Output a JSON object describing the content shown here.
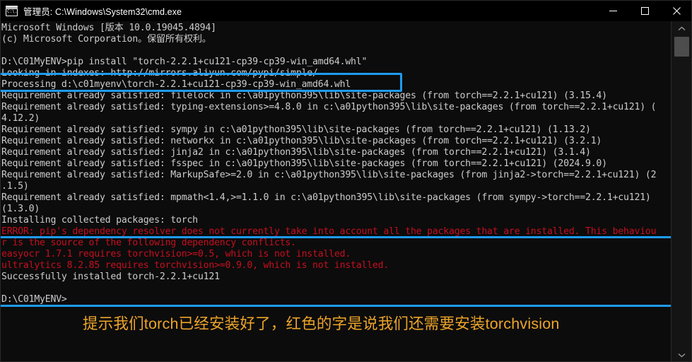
{
  "window": {
    "title": "管理员: C:\\Windows\\System32\\cmd.exe",
    "icon": "cmd-console-icon",
    "icon_glyph": "C:\\.",
    "minimize_label": "—",
    "maximize_label": "□",
    "close_label": "✕"
  },
  "colors": {
    "background": "#0c0c0c",
    "titlebar": "#000000",
    "text": "#cccccc",
    "error_text": "#c50f1f",
    "highlight_box": "#1e9bf0",
    "annotation_text": "#eda42a",
    "scrollbar_track": "#141414",
    "scrollbar_thumb": "#4d4d4d"
  },
  "console": {
    "lines": [
      {
        "text": "Microsoft Windows [版本 10.0.19045.4894]",
        "color": "white"
      },
      {
        "text": "(c) Microsoft Corporation。保留所有权利。",
        "color": "white"
      },
      {
        "text": "",
        "color": "white"
      },
      {
        "text": "D:\\C01MyENV>pip install \"torch-2.2.1+cu121-cp39-cp39-win_amd64.whl\"",
        "color": "white"
      },
      {
        "text": "Looking in indexes: http://mirrors.aliyun.com/pypi/simple/",
        "color": "white"
      },
      {
        "text": "Processing d:\\c01myenv\\torch-2.2.1+cu121-cp39-cp39-win_amd64.whl",
        "color": "white"
      },
      {
        "text": "Requirement already satisfied: filelock in c:\\a01python395\\lib\\site-packages (from torch==2.2.1+cu121) (3.15.4)",
        "color": "white"
      },
      {
        "text": "Requirement already satisfied: typing-extensions>=4.8.0 in c:\\a01python395\\lib\\site-packages (from torch==2.2.1+cu121) (",
        "color": "white"
      },
      {
        "text": "4.12.2)",
        "color": "white"
      },
      {
        "text": "Requirement already satisfied: sympy in c:\\a01python395\\lib\\site-packages (from torch==2.2.1+cu121) (1.13.2)",
        "color": "white"
      },
      {
        "text": "Requirement already satisfied: networkx in c:\\a01python395\\lib\\site-packages (from torch==2.2.1+cu121) (3.2.1)",
        "color": "white"
      },
      {
        "text": "Requirement already satisfied: jinja2 in c:\\a01python395\\lib\\site-packages (from torch==2.2.1+cu121) (3.1.4)",
        "color": "white"
      },
      {
        "text": "Requirement already satisfied: fsspec in c:\\a01python395\\lib\\site-packages (from torch==2.2.1+cu121) (2024.9.0)",
        "color": "white"
      },
      {
        "text": "Requirement already satisfied: MarkupSafe>=2.0 in c:\\a01python395\\lib\\site-packages (from jinja2->torch==2.2.1+cu121) (2",
        "color": "white"
      },
      {
        "text": ".1.5)",
        "color": "white"
      },
      {
        "text": "Requirement already satisfied: mpmath<1.4,>=1.1.0 in c:\\a01python395\\lib\\site-packages (from sympy->torch==2.2.1+cu121)",
        "color": "white"
      },
      {
        "text": "(1.3.0)",
        "color": "white"
      },
      {
        "text": "Installing collected packages: torch",
        "color": "white"
      },
      {
        "text": "ERROR: pip's dependency resolver does not currently take into account all the packages that are installed. This behaviou",
        "color": "red"
      },
      {
        "text": "r is the source of the following dependency conflicts.",
        "color": "red"
      },
      {
        "text": "easyocr 1.7.1 requires torchvision>=0.5, which is not installed.",
        "color": "red"
      },
      {
        "text": "ultralytics 8.2.85 requires torchvision>=0.9.0, which is not installed.",
        "color": "red"
      },
      {
        "text": "Successfully installed torch-2.2.1+cu121",
        "color": "white"
      },
      {
        "text": "",
        "color": "white"
      },
      {
        "text": "D:\\C01MyENV>",
        "color": "white"
      }
    ]
  },
  "highlights": {
    "command_box_label": "pip-install-command-highlight",
    "result_box_label": "install-result-highlight"
  },
  "annotation": {
    "text": "提示我们torch已经安装好了，红色的字是说我们还需要安装torchvision"
  },
  "scrollbar": {
    "up_arrow": "▲",
    "down_arrow": "▼"
  }
}
